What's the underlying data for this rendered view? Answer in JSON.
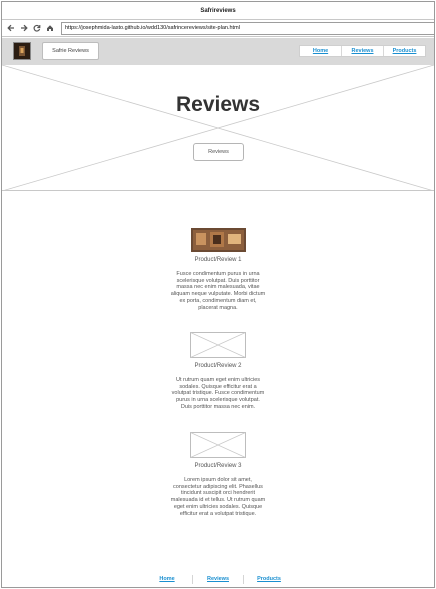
{
  "window": {
    "title": "Safrireviews"
  },
  "browser": {
    "url": "https://josephmida-lasto.github.io/wdd130/safrincereviews/site-plan.html"
  },
  "icons": {
    "back": "back-arrow-icon",
    "forward": "forward-arrow-icon",
    "reload": "reload-icon",
    "home": "home-icon"
  },
  "header": {
    "brand_label": "Safrie Reviews",
    "nav": [
      "Home",
      "Reviews",
      "Products"
    ]
  },
  "hero": {
    "title": "Reviews",
    "button_label": "Reviews"
  },
  "reviews": [
    {
      "title": "Product/Review 1",
      "body": "Fusce condimentum purus in urna scelerisque volutpat. Duis porttitor massa nec enim malesuada, vitae aliquam neque vulputate. Morbi dictum ex porta, condimentum diam et, placerat magna."
    },
    {
      "title": "Product/Review 2",
      "body": "Ut rutrum quam eget enim ultricies sodales. Quisque efficitur erat a volutpat tristique. Fusce condimentum purus in urna scelerisque volutpat. Duis porttitor massa nec enim."
    },
    {
      "title": "Product/Review 3",
      "body": "Lorem ipsum dolor sit amet, consectetur adipiscing elit. Phasellus tincidunt suscipit orci hendrerit malesuada id et tellus. Ut rutrum quam eget enim ultricies sodales. Quisque efficitur erat a volutpat tristique."
    }
  ],
  "footer": {
    "nav": [
      "Home",
      "Reviews",
      "Products"
    ]
  },
  "colors": {
    "link": "#1a8fd0",
    "header_bg": "#d9d9d9"
  }
}
